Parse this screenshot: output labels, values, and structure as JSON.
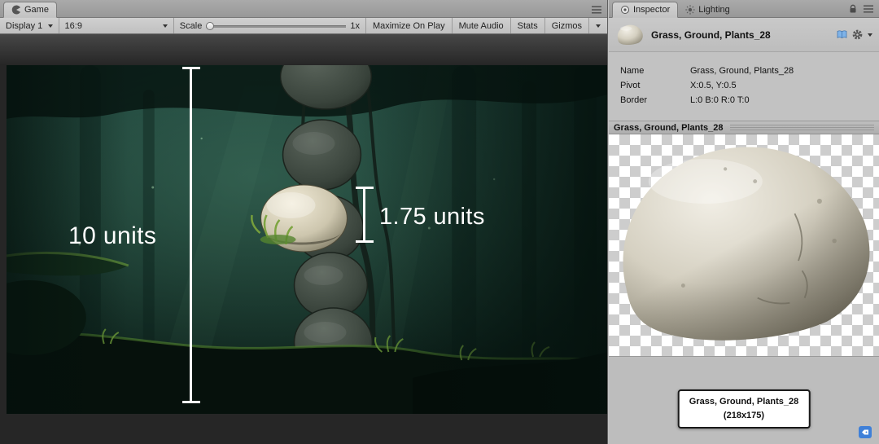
{
  "game": {
    "tab_label": "Game",
    "toolbar": {
      "display": "Display 1",
      "aspect": "16:9",
      "scale_label": "Scale",
      "scale_value": "1x",
      "maximize_label": "Maximize On Play",
      "mute_label": "Mute Audio",
      "stats_label": "Stats",
      "gizmos_label": "Gizmos"
    },
    "scene": {
      "measure_long": "10 units",
      "measure_short": "1.75 units"
    }
  },
  "inspector": {
    "tabs": [
      {
        "label": "Inspector"
      },
      {
        "label": "Lighting"
      }
    ],
    "header": {
      "title": "Grass, Ground, Plants_28"
    },
    "properties": [
      {
        "label": "Name",
        "value": "Grass, Ground, Plants_28"
      },
      {
        "label": "Pivot",
        "value": "X:0.5, Y:0.5"
      },
      {
        "label": "Border",
        "value": "L:0 B:0 R:0 T:0"
      }
    ],
    "preview": {
      "header": "Grass, Ground, Plants_28",
      "caption_name": "Grass, Ground, Plants_28",
      "caption_size": "(218x175)"
    }
  },
  "icons": {
    "game_tab": "game-view-icon",
    "inspector_tab": "inspector-target-icon",
    "lighting_tab": "sun-icon",
    "pane_menu": "hamburger-menu-icon",
    "lock": "lock-icon",
    "open_asset": "book-icon",
    "settings": "gear-icon",
    "sprite_label": "tag-icon"
  },
  "colors": {
    "measure_line": "#ffffff",
    "panel_bg": "#c2c2c2",
    "viewport_bg": "#262626",
    "tag_icon_blue": "#3f80d8"
  }
}
